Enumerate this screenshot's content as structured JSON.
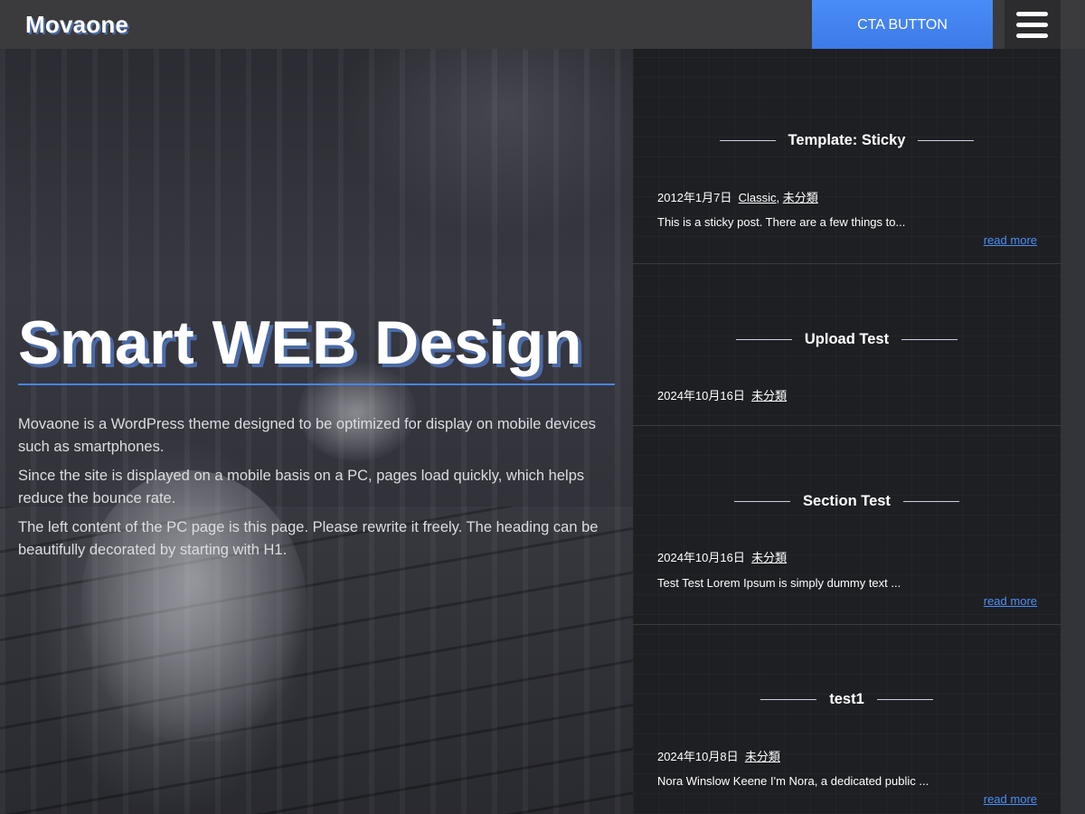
{
  "header": {
    "logo": "Movaone",
    "cta_label": "CTA BUTTON",
    "menu_icon": "hamburger-menu-icon"
  },
  "hero": {
    "title": "Smart WEB Design",
    "paragraphs": [
      "Movaone is a WordPress theme designed to be optimized for display on mobile devices such as smartphones.",
      "Since the site is displayed on a mobile basis on a PC, pages load quickly, which helps reduce the bounce rate.",
      "The left content of the PC page is this page. Please rewrite it freely. The heading can be beautifully decorated by starting with H1."
    ]
  },
  "posts": [
    {
      "title": "Template: Sticky",
      "date": "2012年1月7日",
      "categories": [
        "Classic",
        "未分類"
      ],
      "excerpt": "This is a sticky post. There are a few things to...",
      "read_more": "read more"
    },
    {
      "title": "Upload Test",
      "date": "2024年10月16日",
      "categories": [
        "未分類"
      ],
      "excerpt": "",
      "read_more": ""
    },
    {
      "title": "Section Test",
      "date": "2024年10月16日",
      "categories": [
        "未分類"
      ],
      "excerpt": "Test Test Lorem Ipsum is simply dummy text ...",
      "read_more": "read more"
    },
    {
      "title": "test1",
      "date": "2024年10月8日",
      "categories": [
        "未分類"
      ],
      "excerpt": "Nora Winslow Keene I'm Nora, a dedicated public ...",
      "read_more": "read more"
    }
  ],
  "colors": {
    "accent": "#3c7ae8",
    "link": "#4a8ff5",
    "header_bg": "#3b3b3d"
  }
}
